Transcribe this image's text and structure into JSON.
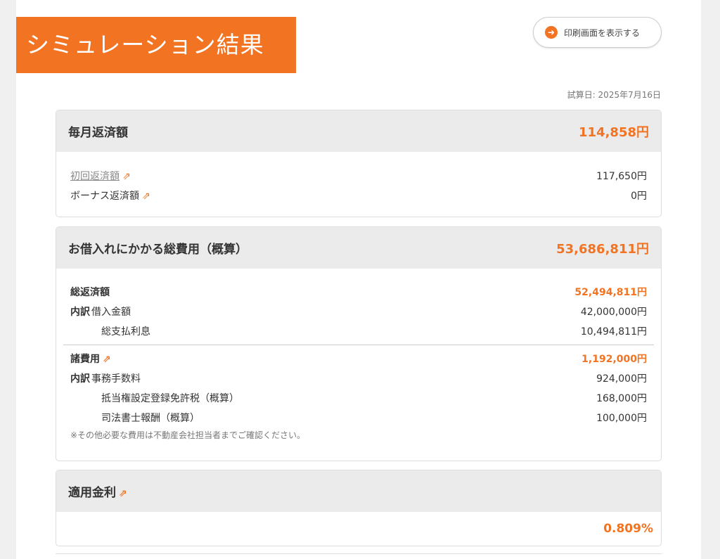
{
  "header": {
    "title": "シミュレーション結果",
    "print_button": "印刷画面を表示する",
    "calc_date": "試算日: 2025年7月16日"
  },
  "monthly": {
    "title": "毎月返済額",
    "value": "114,858円",
    "rows": [
      {
        "label": "初回返済額",
        "value": "117,650円"
      },
      {
        "label": "ボーナス返済額",
        "value": "0円"
      }
    ]
  },
  "total_cost": {
    "title": "お借入れにかかる総費用（概算）",
    "value": "53,686,811円",
    "repayment": {
      "label": "総返済額",
      "value": "52,494,811円",
      "breakdown_label": "内訳",
      "items": [
        {
          "label": "借入金額",
          "value": "42,000,000円"
        },
        {
          "label": "総支払利息",
          "value": "10,494,811円"
        }
      ]
    },
    "fees": {
      "label": "諸費用",
      "value": "1,192,000円",
      "breakdown_label": "内訳",
      "items": [
        {
          "label": "事務手数料",
          "value": "924,000円"
        },
        {
          "label": "抵当権設定登録免許税（概算）",
          "value": "168,000円"
        },
        {
          "label": "司法書士報酬（概算）",
          "value": "100,000円"
        }
      ]
    },
    "note": "※その他必要な費用は不動産会社担当者までご確認ください。"
  },
  "rate": {
    "title": "適用金利",
    "value": "0.809%"
  },
  "colors": {
    "accent": "#f27322",
    "header_bg": "#ebebeb"
  }
}
